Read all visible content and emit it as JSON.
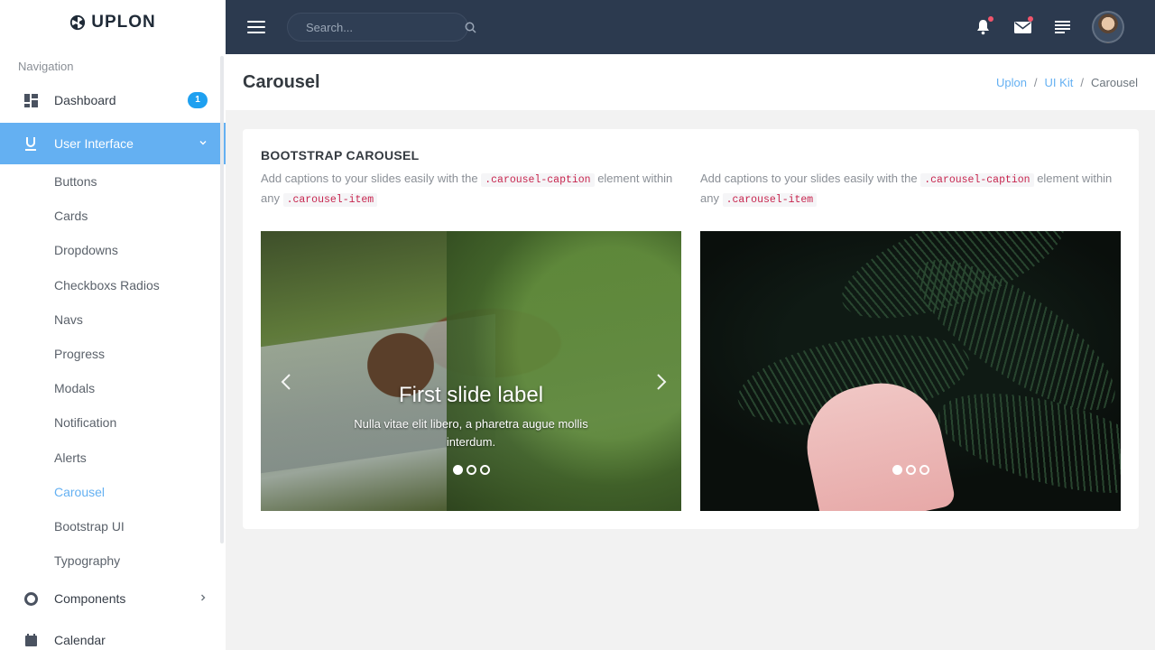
{
  "brand": {
    "name": "UPLON"
  },
  "sidebar": {
    "heading": "Navigation",
    "dashboard": {
      "label": "Dashboard",
      "badge": "1"
    },
    "user_interface": {
      "label": "User Interface"
    },
    "sub_items": [
      "Buttons",
      "Cards",
      "Dropdowns",
      "Checkboxs Radios",
      "Navs",
      "Progress",
      "Modals",
      "Notification",
      "Alerts",
      "Carousel",
      "Bootstrap UI",
      "Typography"
    ],
    "current_sub_item": "Carousel",
    "components": {
      "label": "Components"
    },
    "calendar": {
      "label": "Calendar"
    }
  },
  "topbar": {
    "search_placeholder": "Search..."
  },
  "page": {
    "title": "Carousel",
    "breadcrumb": [
      "Uplon",
      "UI Kit",
      "Carousel"
    ]
  },
  "card": {
    "title": "BOOTSTRAP CAROUSEL",
    "desc_left": {
      "before": "Add captions to your slides easily with the ",
      "code1": ".carousel-caption",
      "middle": " element within any ",
      "code2": ".carousel-item"
    },
    "desc_right": {
      "before": "Add captions to your slides easily with the ",
      "code1": ".carousel-caption",
      "middle": " element within any ",
      "code2": ".carousel-item"
    },
    "carousel_left": {
      "caption_title": "First slide label",
      "caption_text": "Nulla vitae elit libero, a pharetra augue mollis interdum."
    }
  },
  "colors": {
    "topbar": "#2c3a4f",
    "accent": "#64b0f2",
    "badge": "#1ea0f0",
    "notification_dot": "#f1556c"
  },
  "icons": [
    "radiation-logo-icon",
    "dashboard-icon",
    "underline-icon",
    "chevron-down-icon",
    "life-ring-icon",
    "calendar-icon",
    "hamburger-menu-icon",
    "search-icon",
    "bell-icon",
    "mail-icon",
    "list-icon",
    "avatar",
    "chevron-left-icon",
    "chevron-right-icon"
  ]
}
